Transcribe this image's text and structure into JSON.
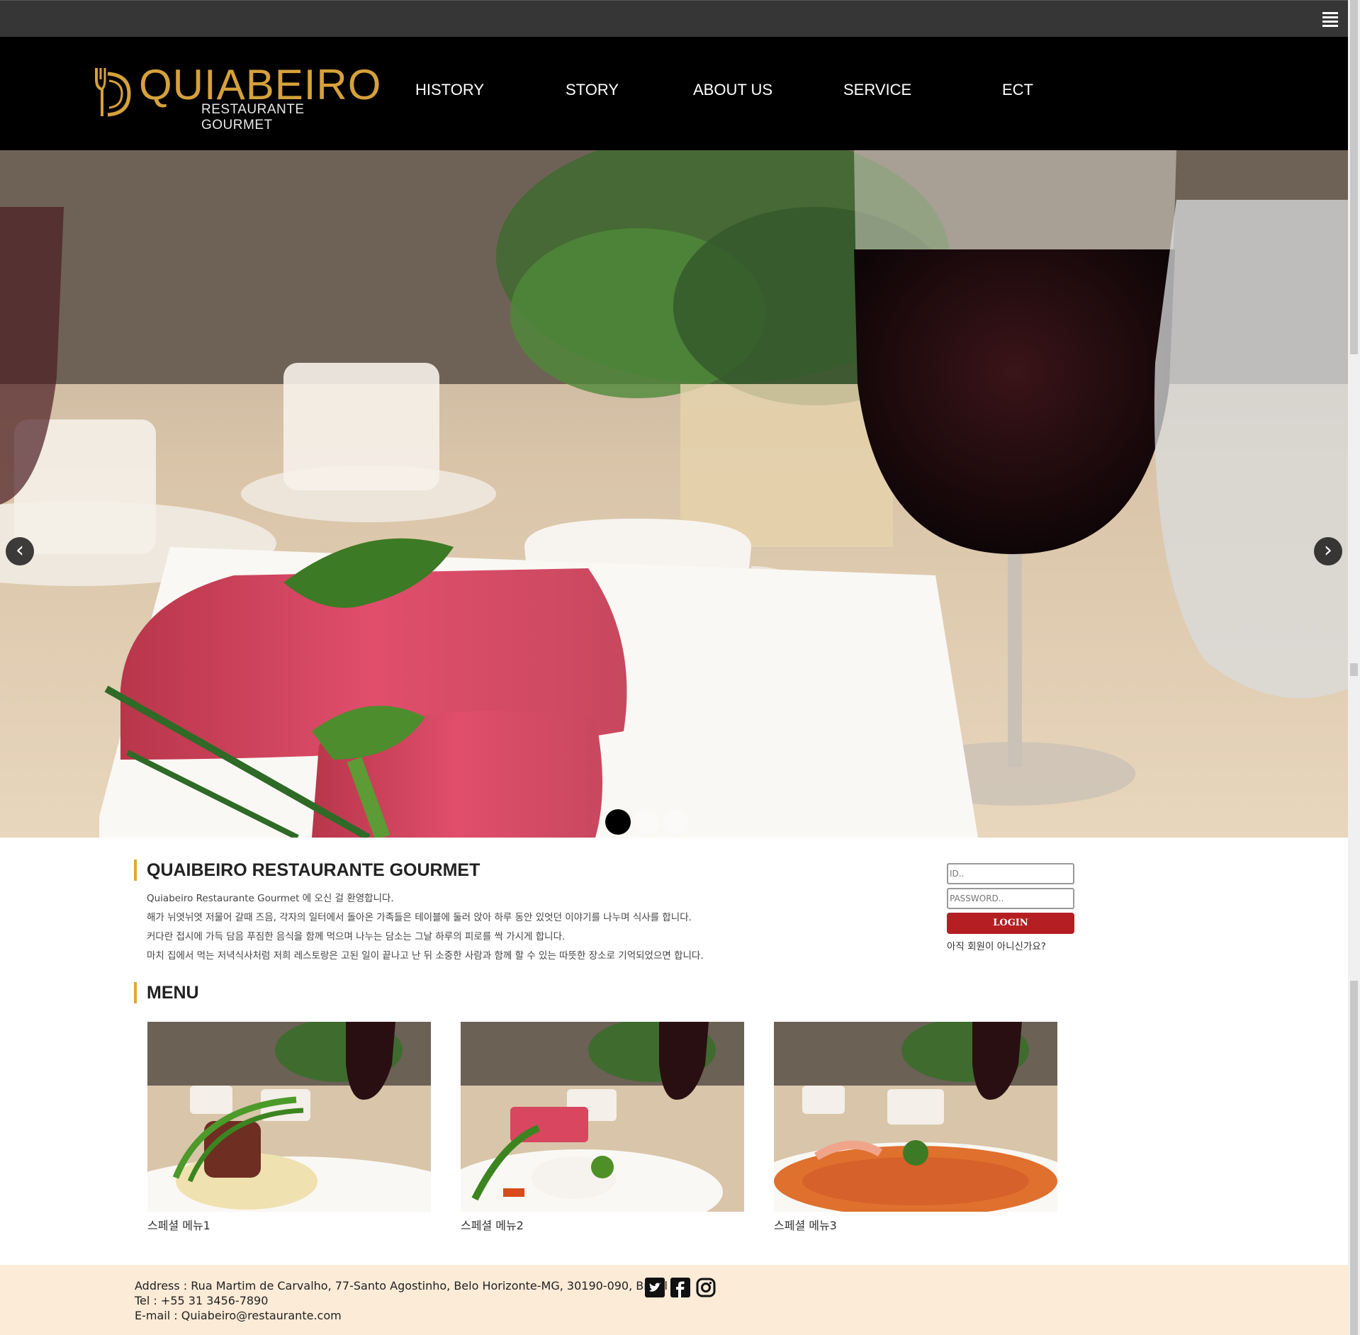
{
  "brand": {
    "name": "QUIABEIRO",
    "tagline": "RESTAURANTE GOURMET",
    "accent_color": "#d6a13b"
  },
  "topbar": {
    "menu_icon": "hamburger-icon"
  },
  "nav": {
    "items": [
      {
        "label": "HISTORY"
      },
      {
        "label": "STORY"
      },
      {
        "label": "ABOUT US"
      },
      {
        "label": "SERVICE"
      },
      {
        "label": "ECT"
      }
    ]
  },
  "slider": {
    "prev_label": "‹",
    "next_label": "›",
    "slide_count": 3,
    "active_slide": 1
  },
  "intro": {
    "title": "QUAIBEIRO RESTAURANTE GOURMET",
    "lines": [
      "Quiabeiro Restaurante Gourmet 에 오신 걸 환영합니다.",
      "해가 뉘엿뉘엿 저물어 갈때 즈음, 각자의 일터에서 돌아온 가족들은 테이블에 둘러 앉아 하루 동안 있엇던 이야기를 나누며 식사를 합니다.",
      "커다란 접시에 가득 담음 푸짐한 음식을 함께 먹으며 나누는 담소는 그날 하루의 피로를 싹 가시게 합니다.",
      "마치 집에서 먹는 저녁식사처럼 저희 레스토랑은 고된 일이 끝나고 난 뒤 소중한 사람과 함께 할 수 있는 따뜻한 장소로 기억되었으면 합니다."
    ]
  },
  "login": {
    "id_placeholder": "ID..",
    "password_placeholder": "PASSWORD..",
    "button_label": "LOGIN",
    "signup_text": "아직 회원이 아니신가요?",
    "button_color": "#b51f23"
  },
  "menu": {
    "title": "MENU",
    "items": [
      {
        "caption": "스페셜 메뉴1"
      },
      {
        "caption": "스페셜 메뉴2"
      },
      {
        "caption": "스페셜 메뉴3"
      }
    ]
  },
  "footer": {
    "address": "Address : Rua Martim de Carvalho, 77-Santo Agostinho, Belo Horizonte-MG, 30190-090, Brazil",
    "tel": "Tel : +55 31 3456-7890",
    "email": "E-mail : Quiabeiro@restaurante.com",
    "social": [
      "twitter-icon",
      "facebook-icon",
      "instagram-icon"
    ],
    "background": "#fbebd7"
  }
}
